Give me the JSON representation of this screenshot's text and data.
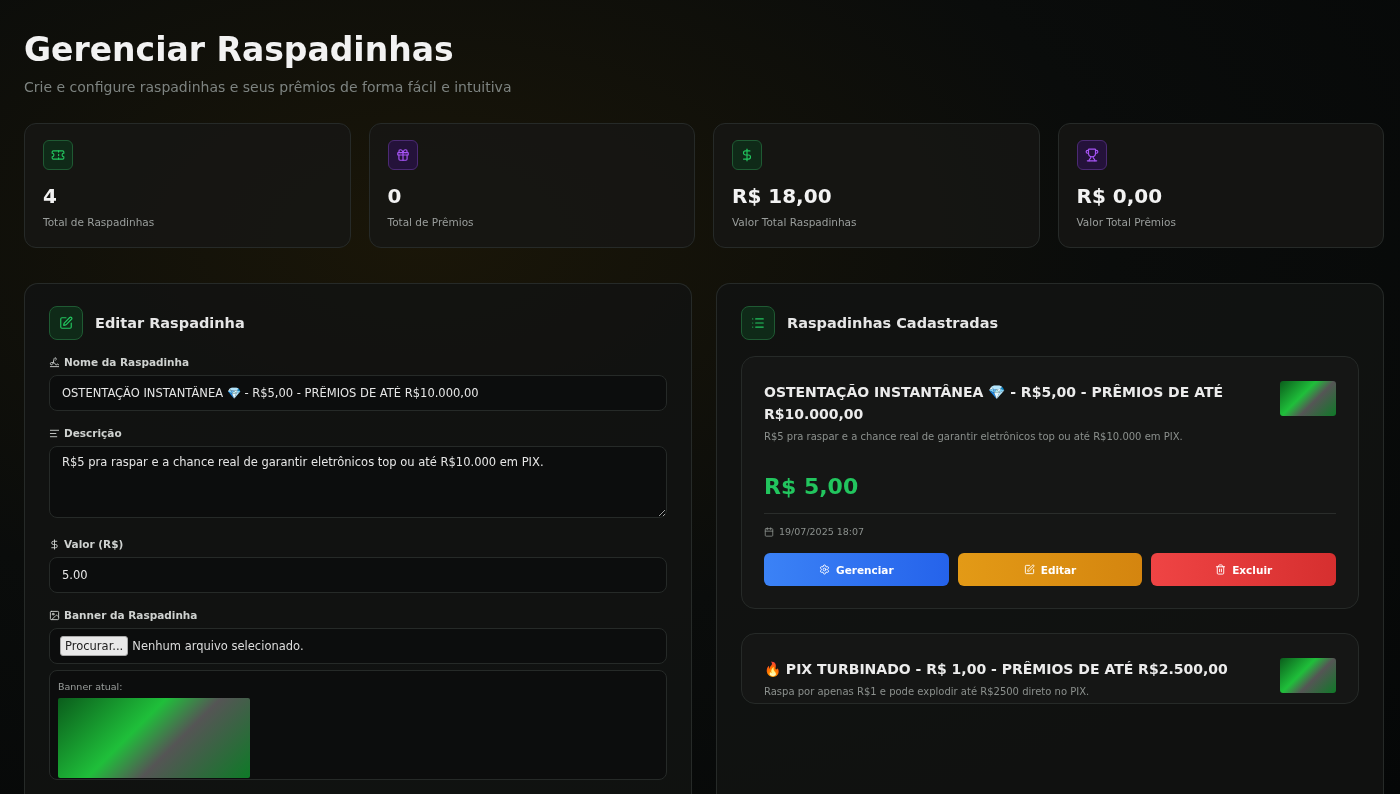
{
  "header": {
    "title": "Gerenciar Raspadinhas",
    "subtitle": "Crie e configure raspadinhas e seus prêmios de forma fácil e intuitiva"
  },
  "stats": [
    {
      "kind": "ticket",
      "value": "4",
      "label": "Total de Raspadinhas"
    },
    {
      "kind": "gift",
      "value": "0",
      "label": "Total de Prêmios"
    },
    {
      "kind": "money",
      "value": "R$ 18,00",
      "label": "Valor Total Raspadinhas"
    },
    {
      "kind": "trophy",
      "value": "R$ 0,00",
      "label": "Valor Total Prêmios"
    }
  ],
  "edit_panel": {
    "title": "Editar Raspadinha",
    "fields": [
      {
        "kind": "text",
        "label": "Nome da Raspadinha",
        "value": "OSTENTAÇÃO INSTANTÂNEA 💎 - R$5,00 - PRÊMIOS DE ATÉ R$10.000,00"
      },
      {
        "kind": "textarea",
        "label": "Descrição",
        "value": "R$5 pra raspar e a chance real de garantir eletrônicos top ou até R$10.000 em PIX."
      },
      {
        "kind": "text",
        "label": "Valor (R$)",
        "value": "5.00"
      },
      {
        "kind": "file",
        "label": "Banner da Raspadinha",
        "button": "Procurar...",
        "status": "Nenhum arquivo selecionado."
      },
      {
        "kind": "banner",
        "caption": "Banner atual:"
      }
    ]
  },
  "list_panel": {
    "title": "Raspadinhas Cadastradas",
    "items": [
      {
        "title": "OSTENTAÇÃO INSTANTÂNEA 💎 - R$5,00 - PRÊMIOS DE ATÉ R$10.000,00",
        "description": "R$5 pra raspar e a chance real de garantir eletrônicos top ou até R$10.000 em PIX.",
        "price": "R$ 5,00",
        "date": "19/07/2025 18:07",
        "buttons": [
          {
            "kind": "manage",
            "label": "Gerenciar"
          },
          {
            "kind": "edit",
            "label": "Editar"
          },
          {
            "kind": "delete",
            "label": "Excluir"
          }
        ]
      },
      {
        "title": "🔥 PIX TURBINADO - R$ 1,00 - PRÊMIOS DE ATÉ R$2.500,00",
        "description": "Raspa por apenas R$1 e pode explodir até R$2500 direto no PIX."
      }
    ]
  }
}
